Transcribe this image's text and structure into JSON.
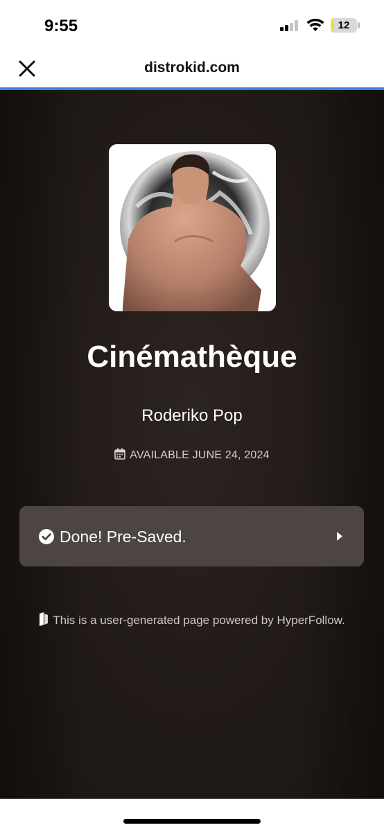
{
  "status_bar": {
    "time": "9:55",
    "battery_level": "12",
    "battery_color": "#f2d84a"
  },
  "browser": {
    "domain": "distrokid.com",
    "close_icon": "close-icon",
    "accent_color": "#3a82d6"
  },
  "release": {
    "cover_icon": "album-cover-image",
    "title": "Cinémathèque",
    "artist": "Roderiko Pop",
    "availability_icon": "calendar-icon",
    "availability": "AVAILABLE JUNE 24, 2024"
  },
  "presave": {
    "icon": "check-circle-icon",
    "label": "Done! Pre-Saved.",
    "arrow_icon": "play-arrow-icon"
  },
  "footer": {
    "icon": "hyperfollow-logo-icon",
    "text": "This is a user-generated page powered by HyperFollow."
  }
}
